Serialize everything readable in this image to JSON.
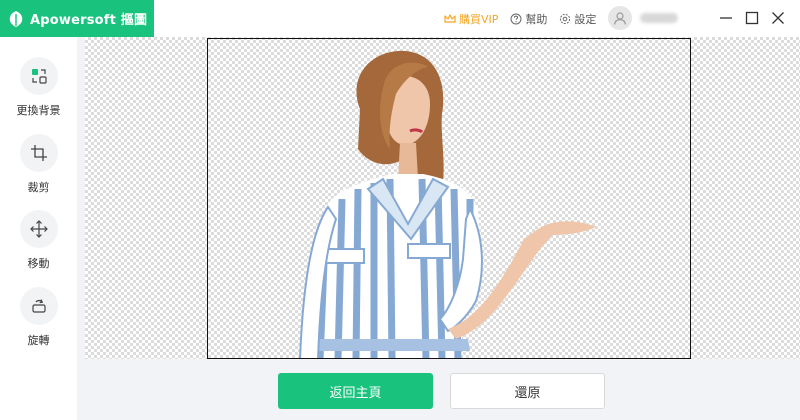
{
  "app": {
    "name": "Apowersoft 摳圖",
    "brand_color": "#19c37d"
  },
  "topmenu": {
    "vip_label": "購買VIP",
    "help_label": "幫助",
    "settings_label": "設定",
    "vip_color": "#f5a524"
  },
  "sidebar": {
    "items": [
      {
        "label": "更換背景",
        "icon": "swap-background-icon"
      },
      {
        "label": "裁剪",
        "icon": "crop-icon"
      },
      {
        "label": "移動",
        "icon": "move-icon"
      },
      {
        "label": "旋轉",
        "icon": "rotate-icon"
      }
    ]
  },
  "actions": {
    "home_label": "返回主頁",
    "restore_label": "還原"
  }
}
